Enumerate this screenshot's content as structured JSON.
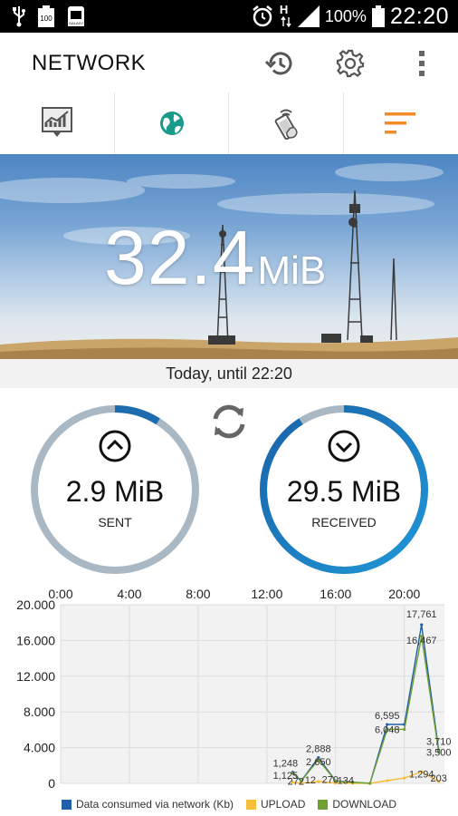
{
  "status_bar": {
    "battery_percent": "100%",
    "time": "22:20",
    "network_type": "H",
    "icons": [
      "usb-icon",
      "battery-100-notification-icon",
      "gallery-notification-icon",
      "alarm-icon",
      "data-arrows-icon",
      "signal-icon",
      "battery-icon"
    ]
  },
  "app_bar": {
    "title": "NETWORK",
    "actions": [
      "history-icon",
      "settings-gear-icon",
      "overflow-menu-icon"
    ]
  },
  "tabs": [
    {
      "icon": "usage-chart-icon",
      "active": false
    },
    {
      "icon": "globe-icon",
      "active": false
    },
    {
      "icon": "phone-wifi-icon",
      "active": false
    },
    {
      "icon": "sort-list-icon",
      "active": true
    }
  ],
  "hero": {
    "value": "32.4",
    "unit": "MiB"
  },
  "period_label": "Today, until 22:20",
  "sent": {
    "value": "2.9 MiB",
    "label": "SENT",
    "fraction": 0.09
  },
  "received": {
    "value": "29.5 MiB",
    "label": "RECEIVED",
    "fraction": 0.91
  },
  "colors": {
    "accent": "#f28c28",
    "teal": "#1a9a8c",
    "sent_arc": "#1e6bb0",
    "received_arc_start": "#1f97d8",
    "received_arc_end": "#1a63a8",
    "ring_track": "#a9b8c2",
    "network_series": "#1f5fa8",
    "upload_series": "#f7be3a",
    "download_series": "#70a030"
  },
  "chart_data": {
    "type": "line",
    "x_ticks": [
      "0:00",
      "4:00",
      "8:00",
      "12:00",
      "16:00",
      "20:00"
    ],
    "y_ticks": [
      "20.000",
      "16.000",
      "12.000",
      "8.000",
      "4.000",
      "0"
    ],
    "ylim": [
      0,
      20000
    ],
    "xlim": [
      0,
      22.33
    ],
    "grid": true,
    "legend_position": "bottom",
    "series": [
      {
        "name": "Data consumed via network (Kb)",
        "color": "#1f5fa8",
        "points": [
          [
            13.5,
            1248
          ],
          [
            14.0,
            272
          ],
          [
            15.0,
            2888
          ],
          [
            16.0,
            270
          ],
          [
            17.0,
            134
          ],
          [
            18.0,
            0
          ],
          [
            19.0,
            6595
          ],
          [
            20.0,
            6595
          ],
          [
            21.0,
            17761
          ],
          [
            22.0,
            3710
          ]
        ]
      },
      {
        "name": "UPLOAD",
        "color": "#f7be3a",
        "points": [
          [
            13.5,
            123
          ],
          [
            14.0,
            12
          ],
          [
            15.0,
            200
          ],
          [
            16.0,
            20
          ],
          [
            17.0,
            15
          ],
          [
            18.0,
            0
          ],
          [
            19.0,
            300
          ],
          [
            20.0,
            600
          ],
          [
            21.0,
            1294
          ],
          [
            22.0,
            203
          ]
        ]
      },
      {
        "name": "DOWNLOAD",
        "color": "#70a030",
        "points": [
          [
            13.5,
            1125
          ],
          [
            14.0,
            260
          ],
          [
            15.0,
            2650
          ],
          [
            16.0,
            250
          ],
          [
            17.0,
            119
          ],
          [
            18.0,
            0
          ],
          [
            19.0,
            6048
          ],
          [
            20.0,
            6048
          ],
          [
            21.0,
            16467
          ],
          [
            22.0,
            3500
          ]
        ]
      }
    ],
    "data_labels": [
      "1,248",
      "1,125",
      "272",
      "12",
      "2,888",
      "2,650",
      "270",
      "134",
      "6,595",
      "6,048",
      "17,761",
      "16,467",
      "1,294",
      "3,710",
      "3,500",
      "203"
    ]
  }
}
